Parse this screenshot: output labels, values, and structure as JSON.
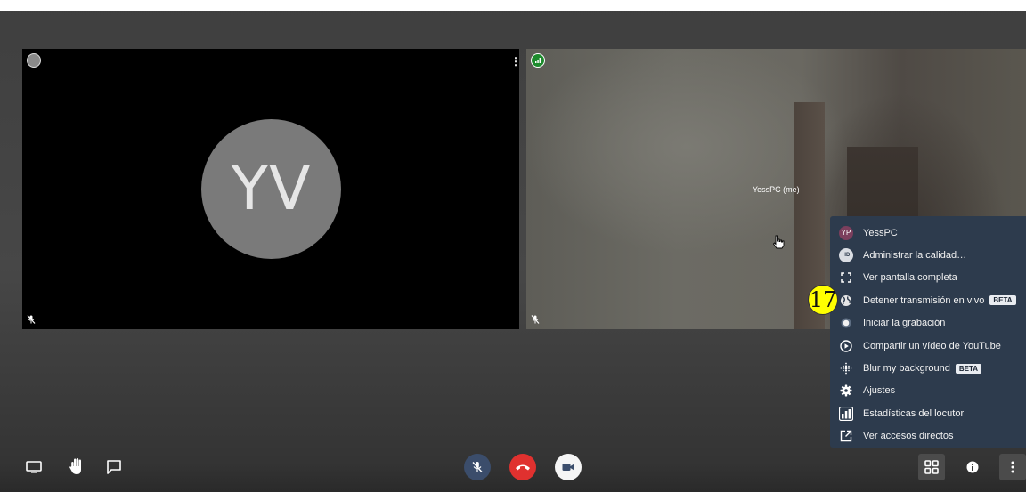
{
  "participants": {
    "local": {
      "initials": "YV"
    },
    "remote": {
      "name_label": "YessPC (me)"
    }
  },
  "context_menu": {
    "items": [
      {
        "label": "YessPC",
        "icon": "avatar-yp-icon",
        "avatar_initials": "YP"
      },
      {
        "label": "Administrar la calidad…",
        "icon": "hd-quality-icon",
        "badge_text": "HD"
      },
      {
        "label": "Ver pantalla completa",
        "icon": "fullscreen-icon"
      },
      {
        "label": "Detener transmisión en vivo",
        "icon": "globe-icon",
        "beta": "BETA"
      },
      {
        "label": "Iniciar la grabación",
        "icon": "record-icon"
      },
      {
        "label": "Compartir un vídeo de YouTube",
        "icon": "play-circle-icon"
      },
      {
        "label": "Blur my background",
        "icon": "blur-icon",
        "beta": "BETA"
      },
      {
        "label": "Ajustes",
        "icon": "gear-icon"
      },
      {
        "label": "Estadísticas del locutor",
        "icon": "bar-chart-icon"
      },
      {
        "label": "Ver accesos directos",
        "icon": "external-link-icon"
      }
    ]
  },
  "step_badge": "17",
  "toolbar": {
    "left": [
      "screen-share-icon",
      "raise-hand-icon",
      "chat-icon"
    ],
    "center": [
      "mic-muted-icon",
      "hangup-icon",
      "camera-icon"
    ],
    "right": [
      "tile-view-icon",
      "info-icon",
      "more-options-icon"
    ]
  },
  "colors": {
    "menu_bg": "#2d3b4d",
    "hangup": "#e0312f",
    "mic_button": "#3b4d6b",
    "step_badge": "#ffff00",
    "connection_good": "#1d8b2d"
  }
}
